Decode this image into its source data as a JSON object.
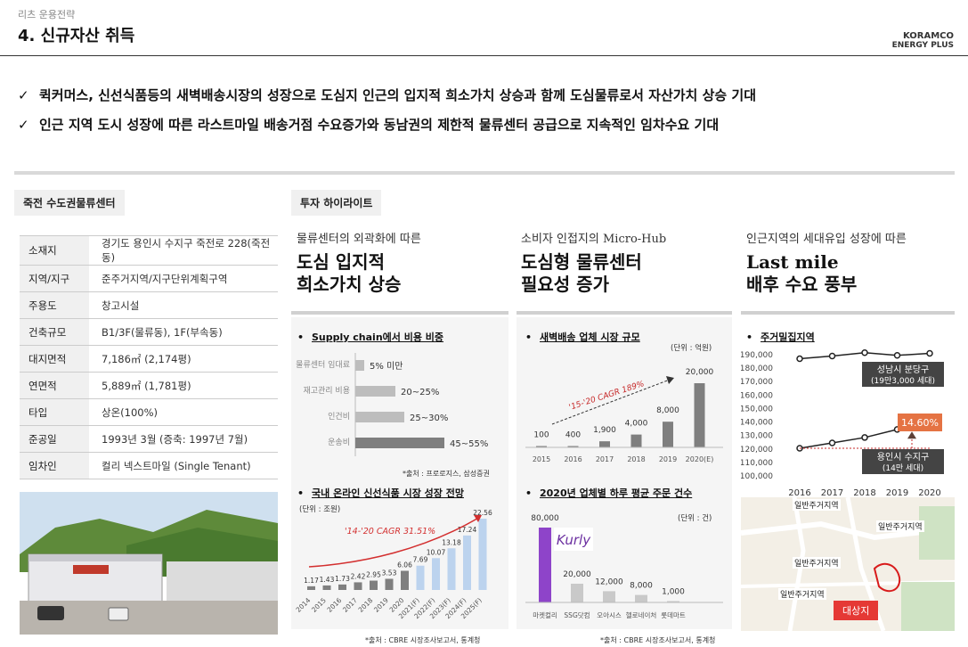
{
  "breadcrumb": "리츠 운용전략",
  "page_title": "4. 신규자산 취득",
  "logo": {
    "line1": "KORAMCO",
    "line2": "ENERGY PLUS"
  },
  "bullets": [
    "퀵커머스, 신선식품등의 새벽배송시장의 성장으로 도심지 인근의 입지적 희소가치 상승과 함께 도심물류로서 자산가치 상승 기대",
    "인근 지역 도시 성장에 따른 라스트마일 배송거점 수요증가와 동남권의 제한적 물류센터 공급으로 지속적인 임차수요 기대"
  ],
  "left_tag": "죽전 수도권물류센터",
  "info_rows": [
    {
      "k": "소재지",
      "v": "경기도 용인시 수지구 죽전로 228(죽전동)"
    },
    {
      "k": "지역/지구",
      "v": "준주거지역/지구단위계획구역"
    },
    {
      "k": "주용도",
      "v": "창고시설"
    },
    {
      "k": "건축규모",
      "v": "B1/3F(물류동), 1F(부속동)"
    },
    {
      "k": "대지면적",
      "v": "7,186㎡ (2,174평)"
    },
    {
      "k": "연면적",
      "v": "5,889㎡ (1,781평)"
    },
    {
      "k": "타입",
      "v": "상온(100%)"
    },
    {
      "k": "준공일",
      "v": "1993년 3월 (증축: 1997년 7월)"
    },
    {
      "k": "임차인",
      "v": "컬리 넥스트마일 (Single Tenant)"
    }
  ],
  "highlight_tag": "투자 하이라이트",
  "columns": [
    {
      "small": "물류센터의 외곽화에 따른",
      "big1": "도심 입지적",
      "big2": "희소가치 상승"
    },
    {
      "small": "소비자 인접지의 Micro-Hub",
      "big1": "도심형 물류센터",
      "big2": "필요성 증가"
    },
    {
      "small": "인근지역의 세대유입 성장에 따른",
      "big1": "Last mile",
      "big2": "배후 수요 풍부"
    }
  ],
  "charts": {
    "supply_title": "Supply chain에서 비용 비중",
    "supply_source": "*출처 : 프로로지스, 삼성증권",
    "online_title": "국내 온라인 신선식품 시장 성장 전망",
    "online_unit": "(단위 : 조원)",
    "online_cagr": "'14-'20 CAGR 31.51%",
    "dawn_title": "새벽배송 업체 시장 규모",
    "dawn_unit": "(단위 : 억원)",
    "dawn_cagr": "'15-'20 CAGR 189%",
    "orders_title": "2020년 업체별 하루 평균 주문 건수",
    "orders_unit": "(단위 : 건)",
    "kurly_logo": "Kurly",
    "housing_title": "주거밀집지역",
    "callout_top_1": "성남시 분당구",
    "callout_top_2": "(19만3,000 세대)",
    "callout_pct": "14.60%",
    "callout_bot_1": "용인시 수지구",
    "callout_bot_2": "(14만 세대)",
    "map_labels": [
      "일반주거지역",
      "일반주거지역",
      "일반주거지역",
      "일반주거지역"
    ],
    "map_target": "대상지",
    "source_mid": "*출처 : CBRE 시장조사보고서, 통계청",
    "source_right": "*출처 : CBRE 시장조사보고서, 통계청"
  },
  "chart_data": [
    {
      "type": "bar",
      "orientation": "horizontal",
      "title": "Supply chain에서 비용 비중",
      "categories": [
        "물류센터 임대료",
        "재고관리 비용",
        "인건비",
        "운송비"
      ],
      "labels": [
        "5% 미만",
        "20~25%",
        "25~30%",
        "45~55%"
      ],
      "values": [
        5,
        22.5,
        27.5,
        50
      ]
    },
    {
      "type": "bar",
      "title": "국내 온라인 신선식품 시장 성장 전망",
      "ylabel": "(단위 : 조원)",
      "categories": [
        "2014",
        "2015",
        "2016",
        "2017",
        "2018",
        "2019",
        "2020",
        "2021(F)",
        "2022(F)",
        "2023(F)",
        "2024(F)",
        "2025(F)"
      ],
      "values": [
        1.17,
        1.43,
        1.73,
        2.42,
        2.95,
        3.53,
        6.06,
        7.69,
        10.07,
        13.18,
        17.24,
        22.56
      ]
    },
    {
      "type": "bar",
      "title": "새벽배송 업체 시장 규모",
      "ylabel": "(단위 : 억원)",
      "categories": [
        "2015",
        "2016",
        "2017",
        "2018",
        "2019",
        "2020(E)"
      ],
      "values": [
        100,
        400,
        1900,
        4000,
        8000,
        20000
      ]
    },
    {
      "type": "bar",
      "title": "2020년 업체별 하루 평균 주문 건수",
      "ylabel": "(단위 : 건)",
      "categories": [
        "마켓컬리",
        "SSG닷컴",
        "오아시스",
        "헬로네이처",
        "롯데마트"
      ],
      "values": [
        80000,
        20000,
        12000,
        8000,
        1000
      ]
    },
    {
      "type": "line",
      "title": "주거밀집지역",
      "x": [
        "2016",
        "2017",
        "2018",
        "2019",
        "2020"
      ],
      "ylim": [
        100000,
        190000
      ],
      "series": [
        {
          "name": "성남시 분당구",
          "values": [
            187000,
            189000,
            191500,
            189500,
            191000
          ]
        },
        {
          "name": "용인시 수지구",
          "values": [
            120500,
            124500,
            128500,
            134500,
            139500
          ]
        }
      ]
    }
  ]
}
